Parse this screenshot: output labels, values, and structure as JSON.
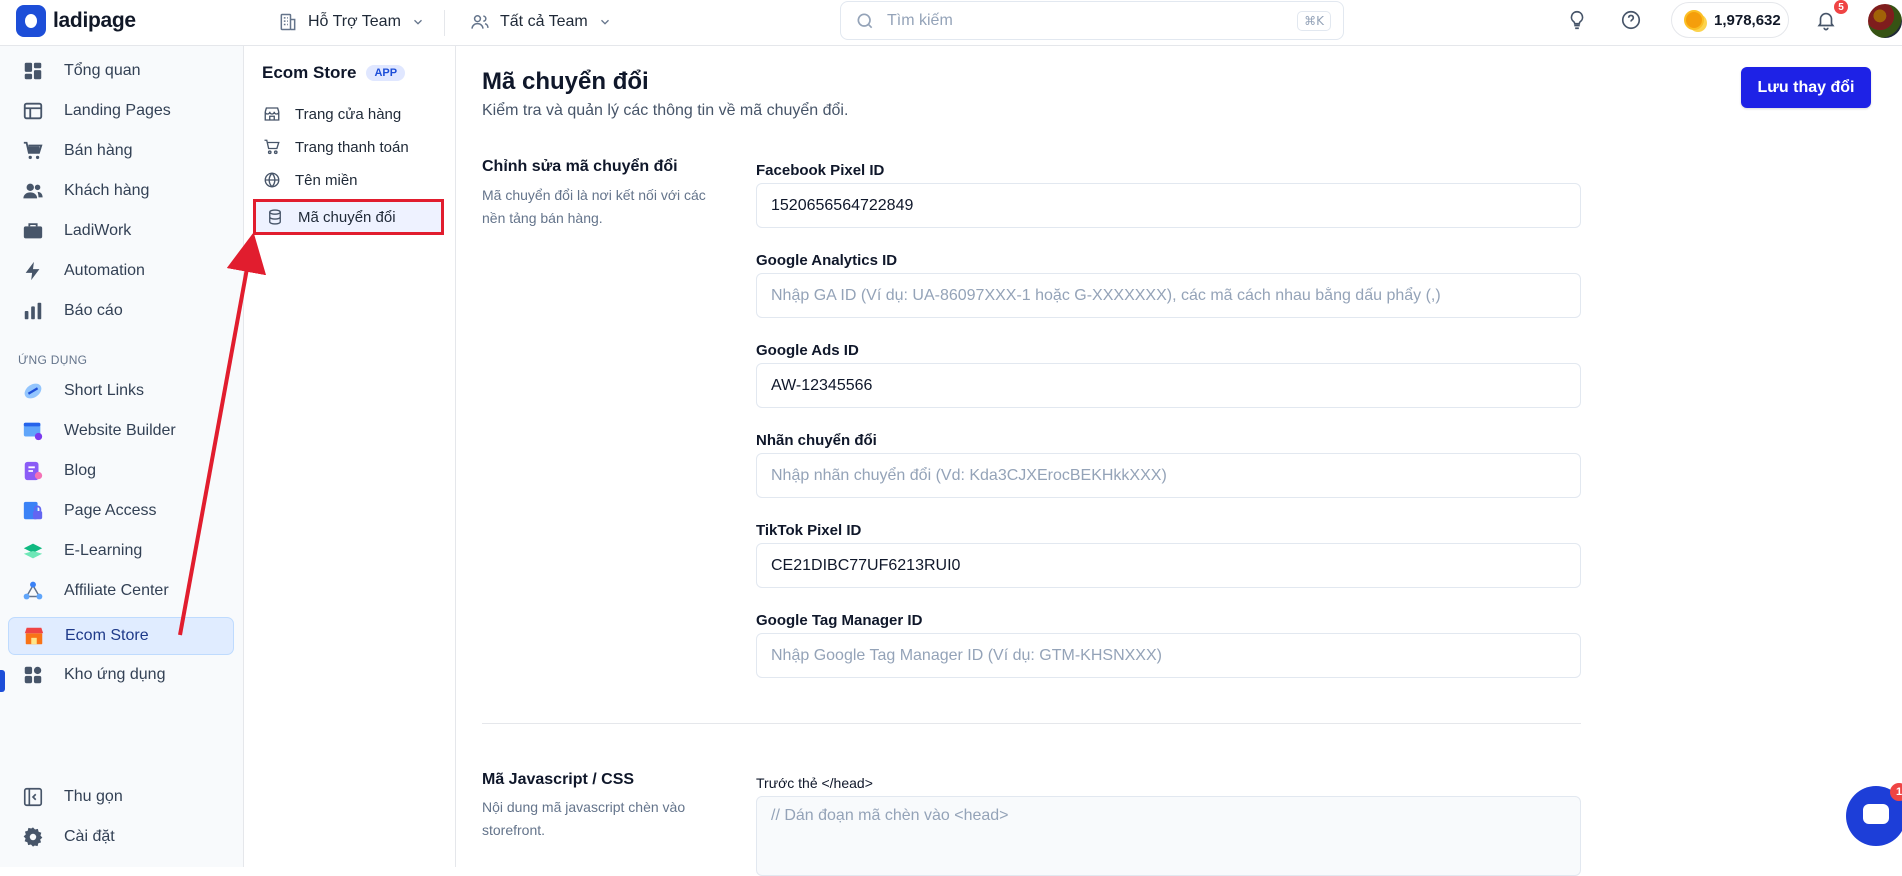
{
  "app": {
    "name": "ladipage"
  },
  "topbar": {
    "team_selector": "Hỗ Trợ Team",
    "team_filter": "Tất cả Team",
    "search_placeholder": "Tìm kiếm",
    "search_shortcut": "⌘K",
    "credits": "1,978,632",
    "notification_count": "5"
  },
  "sidebar": {
    "items": [
      {
        "label": "Tổng quan",
        "icon": "grid-icon"
      },
      {
        "label": "Landing Pages",
        "icon": "layout-icon"
      },
      {
        "label": "Bán hàng",
        "icon": "cart-icon"
      },
      {
        "label": "Khách hàng",
        "icon": "users-icon"
      },
      {
        "label": "LadiWork",
        "icon": "briefcase-icon"
      },
      {
        "label": "Automation",
        "icon": "bolt-icon"
      },
      {
        "label": "Báo cáo",
        "icon": "bar-chart-icon"
      }
    ],
    "section_label": "ỨNG DỤNG",
    "apps": [
      {
        "label": "Short Links",
        "icon": "link-icon"
      },
      {
        "label": "Website Builder",
        "icon": "website-icon"
      },
      {
        "label": "Blog",
        "icon": "blog-icon"
      },
      {
        "label": "Page Access",
        "icon": "lock-icon"
      },
      {
        "label": "E-Learning",
        "icon": "book-icon"
      },
      {
        "label": "Affiliate Center",
        "icon": "network-icon"
      },
      {
        "label": "Ecom Store",
        "icon": "store-icon"
      },
      {
        "label": "Kho ứng dụng",
        "icon": "apps-icon"
      }
    ],
    "collapse_label": "Thu gọn",
    "settings_label": "Cài đặt"
  },
  "subsidebar": {
    "title": "Ecom Store",
    "badge": "APP",
    "items": [
      {
        "label": "Trang cửa hàng",
        "icon": "store-icon"
      },
      {
        "label": "Trang thanh toán",
        "icon": "cart-icon"
      },
      {
        "label": "Tên miền",
        "icon": "globe-icon"
      },
      {
        "label": "Mã chuyển đổi",
        "icon": "database-icon"
      }
    ]
  },
  "main": {
    "title": "Mã chuyển đổi",
    "subtitle": "Kiểm tra và quản lý các thông tin về mã chuyển đổi.",
    "save_label": "Lưu thay đổi",
    "section1": {
      "title": "Chỉnh sửa mã chuyển đổi",
      "desc": "Mã chuyển đổi là nơi kết nối với các nền tảng bán hàng."
    },
    "fields": [
      {
        "label": "Facebook Pixel ID",
        "value": "1520656564722849",
        "placeholder": ""
      },
      {
        "label": "Google Analytics ID",
        "value": "",
        "placeholder": "Nhập GA ID (Ví dụ: UA-86097XXX-1 hoặc G-XXXXXXX), các mã cách nhau bằng dấu phẩy (,)"
      },
      {
        "label": "Google Ads ID",
        "value": "AW-12345566",
        "placeholder": ""
      },
      {
        "label": "Nhãn chuyển đổi",
        "value": "",
        "placeholder": "Nhập nhãn chuyển đổi (Vd: Kda3CJXErocBEKHkkXXX)"
      },
      {
        "label": "TikTok Pixel ID",
        "value": "CE21DIBC77UF6213RUI0",
        "placeholder": ""
      },
      {
        "label": "Google Tag Manager ID",
        "value": "",
        "placeholder": "Nhập Google Tag Manager ID (Ví dụ: GTM-KHSNXXX)"
      }
    ],
    "section2": {
      "title": "Mã Javascript / CSS",
      "desc": "Nội dung mã javascript chèn vào storefront.",
      "field_label": "Trước thẻ </head>",
      "placeholder": "// Dán đoạn mã chèn vào <head>"
    }
  },
  "chat": {
    "badge": "1"
  },
  "colors": {
    "accent": "#1e22e6",
    "highlight": "#e11d2e",
    "active_bg": "#e0ecff"
  }
}
